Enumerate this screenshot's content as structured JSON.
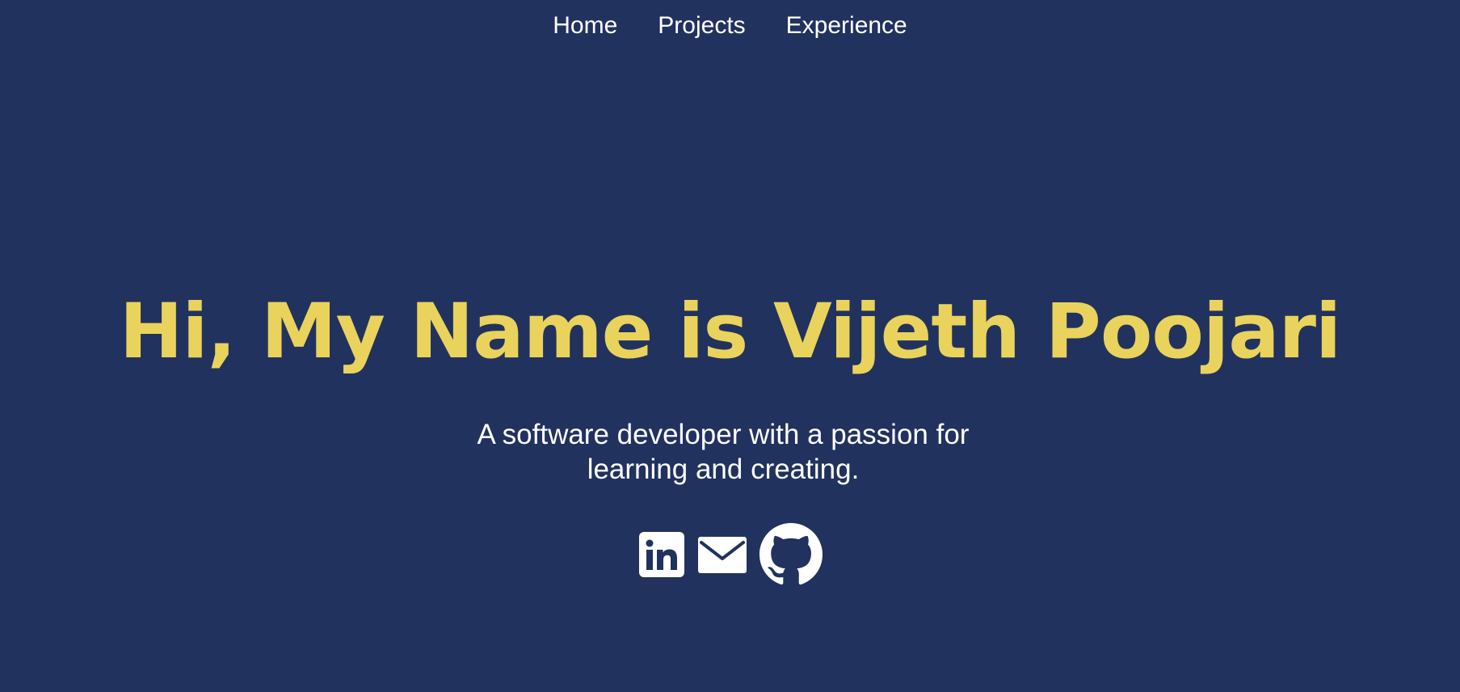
{
  "nav": {
    "items": [
      {
        "label": "Home"
      },
      {
        "label": "Projects"
      },
      {
        "label": "Experience"
      }
    ]
  },
  "hero": {
    "title": "Hi, My Name is Vijeth Poojari",
    "subtitle": "A software developer with a passion for learning and creating."
  },
  "socials": [
    {
      "icon": "linkedin-icon"
    },
    {
      "icon": "email-icon"
    },
    {
      "icon": "github-icon"
    }
  ],
  "colors": {
    "background": "#22325e",
    "accent": "#e9d35c",
    "text": "#ffffff"
  }
}
